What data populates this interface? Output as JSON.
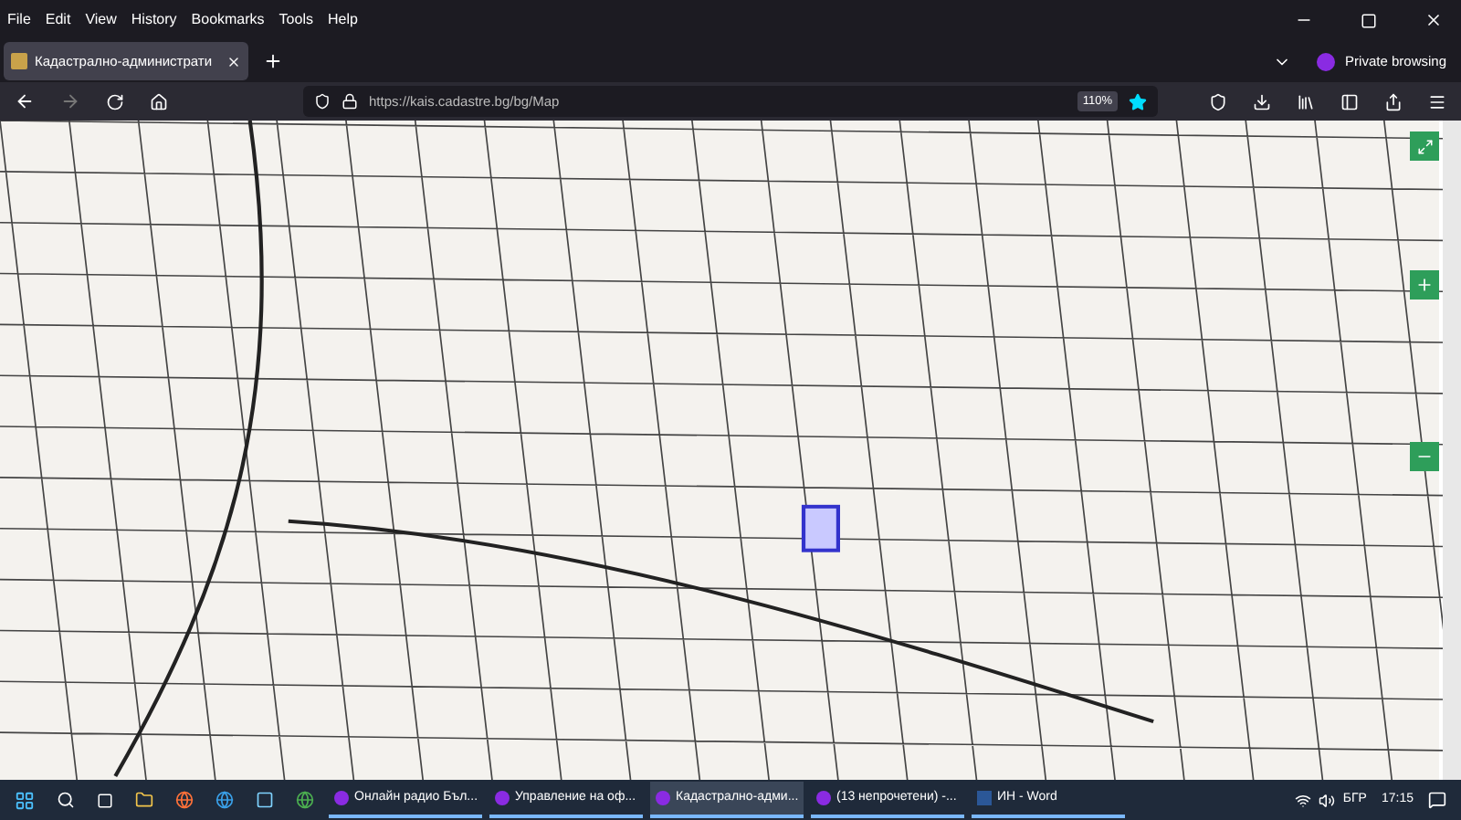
{
  "menu_bar": [
    "File",
    "Edit",
    "View",
    "History",
    "Bookmarks",
    "Tools",
    "Help"
  ],
  "tabs": [
    {
      "label": "Кадастрално-администрати",
      "selected": true
    }
  ],
  "private_label": "Private browsing",
  "address_bar": {
    "value": "https://kais.cadastre.bg/bg/Map",
    "zoom": "110%"
  },
  "taskbar": {
    "items": [
      {
        "label": "Онлайн радио Бъл...",
        "kind": "browser",
        "selected": false
      },
      {
        "label": "Управление на оф...",
        "kind": "browser",
        "selected": false
      },
      {
        "label": "Кадастрално-адми...",
        "kind": "browser",
        "selected": true
      },
      {
        "label": "(13 непрочетени) -...",
        "kind": "browser",
        "selected": false
      },
      {
        "label": "ИН - Word",
        "kind": "word",
        "selected": false
      }
    ],
    "language": "БГР",
    "time": "17:15"
  }
}
